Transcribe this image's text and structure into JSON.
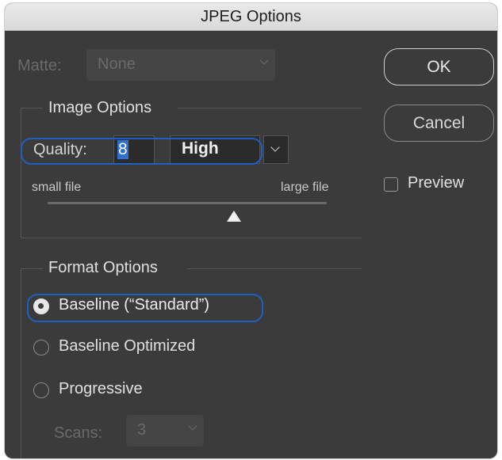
{
  "window": {
    "title": "JPEG Options"
  },
  "matte": {
    "label": "Matte:",
    "value": "None"
  },
  "image_options": {
    "legend": "Image Options",
    "quality_label": "Quality:",
    "quality_value": "8",
    "quality_preset": "High",
    "small_file": "small file",
    "large_file": "large file",
    "slider_value": 8,
    "slider_max": 12
  },
  "buttons": {
    "ok": "OK",
    "cancel": "Cancel"
  },
  "preview": {
    "label": "Preview",
    "checked": false
  },
  "format_options": {
    "legend": "Format Options",
    "radios": [
      {
        "label": "Baseline (“Standard”)",
        "selected": true
      },
      {
        "label": "Baseline Optimized",
        "selected": false
      },
      {
        "label": "Progressive",
        "selected": false
      }
    ],
    "scans_label": "Scans:",
    "scans_value": "3"
  }
}
